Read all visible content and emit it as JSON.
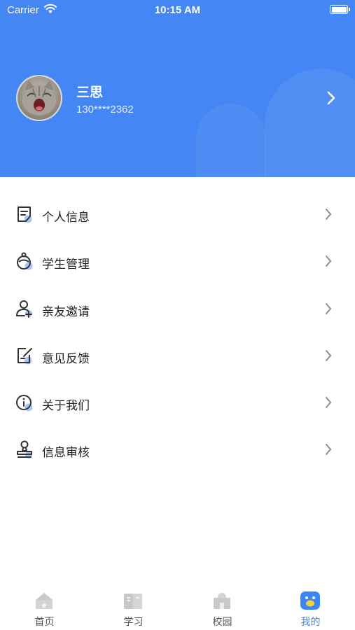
{
  "status_bar": {
    "carrier": "Carrier",
    "time": "10:15 AM"
  },
  "profile": {
    "name": "三思",
    "phone": "130****2362"
  },
  "menu": [
    {
      "label": "个人信息",
      "icon": "document-icon"
    },
    {
      "label": "学生管理",
      "icon": "student-icon"
    },
    {
      "label": "亲友邀请",
      "icon": "invite-user-icon"
    },
    {
      "label": "意见反馈",
      "icon": "feedback-edit-icon"
    },
    {
      "label": "关于我们",
      "icon": "info-icon"
    },
    {
      "label": "信息审核",
      "icon": "stamp-review-icon"
    }
  ],
  "tabs": [
    {
      "label": "首页",
      "icon": "home-icon",
      "active": false
    },
    {
      "label": "学习",
      "icon": "book-icon",
      "active": false
    },
    {
      "label": "校园",
      "icon": "campus-icon",
      "active": false
    },
    {
      "label": "我的",
      "icon": "mine-icon",
      "active": true
    }
  ],
  "colors": {
    "header": "#4486f4",
    "accent": "#3a86f4",
    "tab_inactive": "#c8c8c8"
  }
}
